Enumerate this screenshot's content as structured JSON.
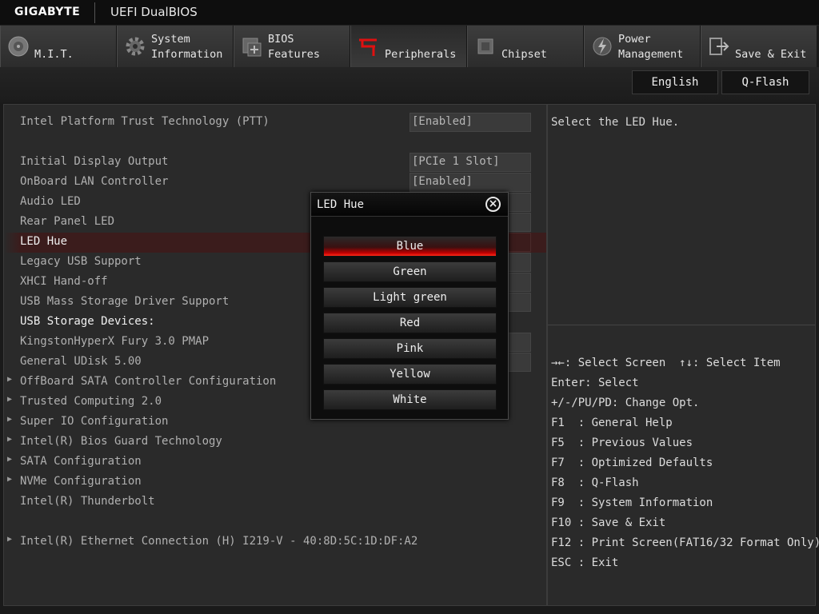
{
  "header": {
    "brand": "GIGABYTE",
    "title": "UEFI DualBIOS"
  },
  "tabs": [
    {
      "label": "\nM.I.T.",
      "icon": "dial-icon"
    },
    {
      "label": "System\nInformation",
      "icon": "gear-icon"
    },
    {
      "label": "BIOS\nFeatures",
      "icon": "chip-plus-icon"
    },
    {
      "label": "\nPeripherals",
      "icon": "peripherals-icon"
    },
    {
      "label": "\nChipset",
      "icon": "chipset-icon"
    },
    {
      "label": "Power\nManagement",
      "icon": "power-bolt-icon"
    },
    {
      "label": "\nSave & Exit",
      "icon": "exit-icon"
    }
  ],
  "active_tab": "Peripherals",
  "toolbar": {
    "language": "English",
    "qflash": "Q-Flash"
  },
  "settings": {
    "ptt": {
      "name": "Intel Platform Trust Technology (PTT)",
      "value": "[Enabled]"
    },
    "display": {
      "name": "Initial Display Output",
      "value": "[PCIe 1 Slot]"
    },
    "lan": {
      "name": "OnBoard LAN Controller",
      "value": "[Enabled]"
    },
    "audio_led": {
      "name": "Audio LED"
    },
    "rear_led": {
      "name": "Rear Panel LED"
    },
    "led_hue": {
      "name": "LED Hue"
    },
    "legacy_usb": {
      "name": "Legacy USB Support"
    },
    "xhci": {
      "name": "XHCI Hand-off"
    },
    "usb_mass": {
      "name": "USB Mass Storage Driver Support"
    },
    "usb_devices": {
      "name": "USB Storage Devices:"
    },
    "kingston": {
      "name": "KingstonHyperX Fury 3.0 PMAP"
    },
    "udisk": {
      "name": "General UDisk 5.00"
    },
    "offboard_sata": {
      "name": "OffBoard SATA Controller Configuration"
    },
    "trusted": {
      "name": "Trusted Computing 2.0"
    },
    "superio": {
      "name": "Super IO Configuration"
    },
    "biosguard": {
      "name": "Intel(R) Bios Guard Technology"
    },
    "sata": {
      "name": "SATA Configuration"
    },
    "nvme": {
      "name": "NVMe Configuration"
    },
    "thunderbolt": {
      "name": "Intel(R) Thunderbolt"
    },
    "ethernet": {
      "name": "Intel(R) Ethernet Connection (H) I219-V - 40:8D:5C:1D:DF:A2"
    }
  },
  "help": {
    "text": "Select the LED Hue."
  },
  "keys": [
    "→←: Select Screen  ↑↓: Select Item",
    "Enter: Select",
    "+/-/PU/PD: Change Opt.",
    "F1  : General Help",
    "F5  : Previous Values",
    "F7  : Optimized Defaults",
    "F8  : Q-Flash",
    "F9  : System Information",
    "F10 : Save & Exit",
    "F12 : Print Screen(FAT16/32 Format Only)",
    "ESC : Exit"
  ],
  "popup": {
    "title": "LED Hue",
    "options": [
      "Blue",
      "Green",
      "Light green",
      "Red",
      "Pink",
      "Yellow",
      "White"
    ],
    "selected": "Blue"
  },
  "colors": {
    "accent": "#c00000",
    "panel": "#2a2a2a",
    "selected_row": "#3b1c1c"
  }
}
